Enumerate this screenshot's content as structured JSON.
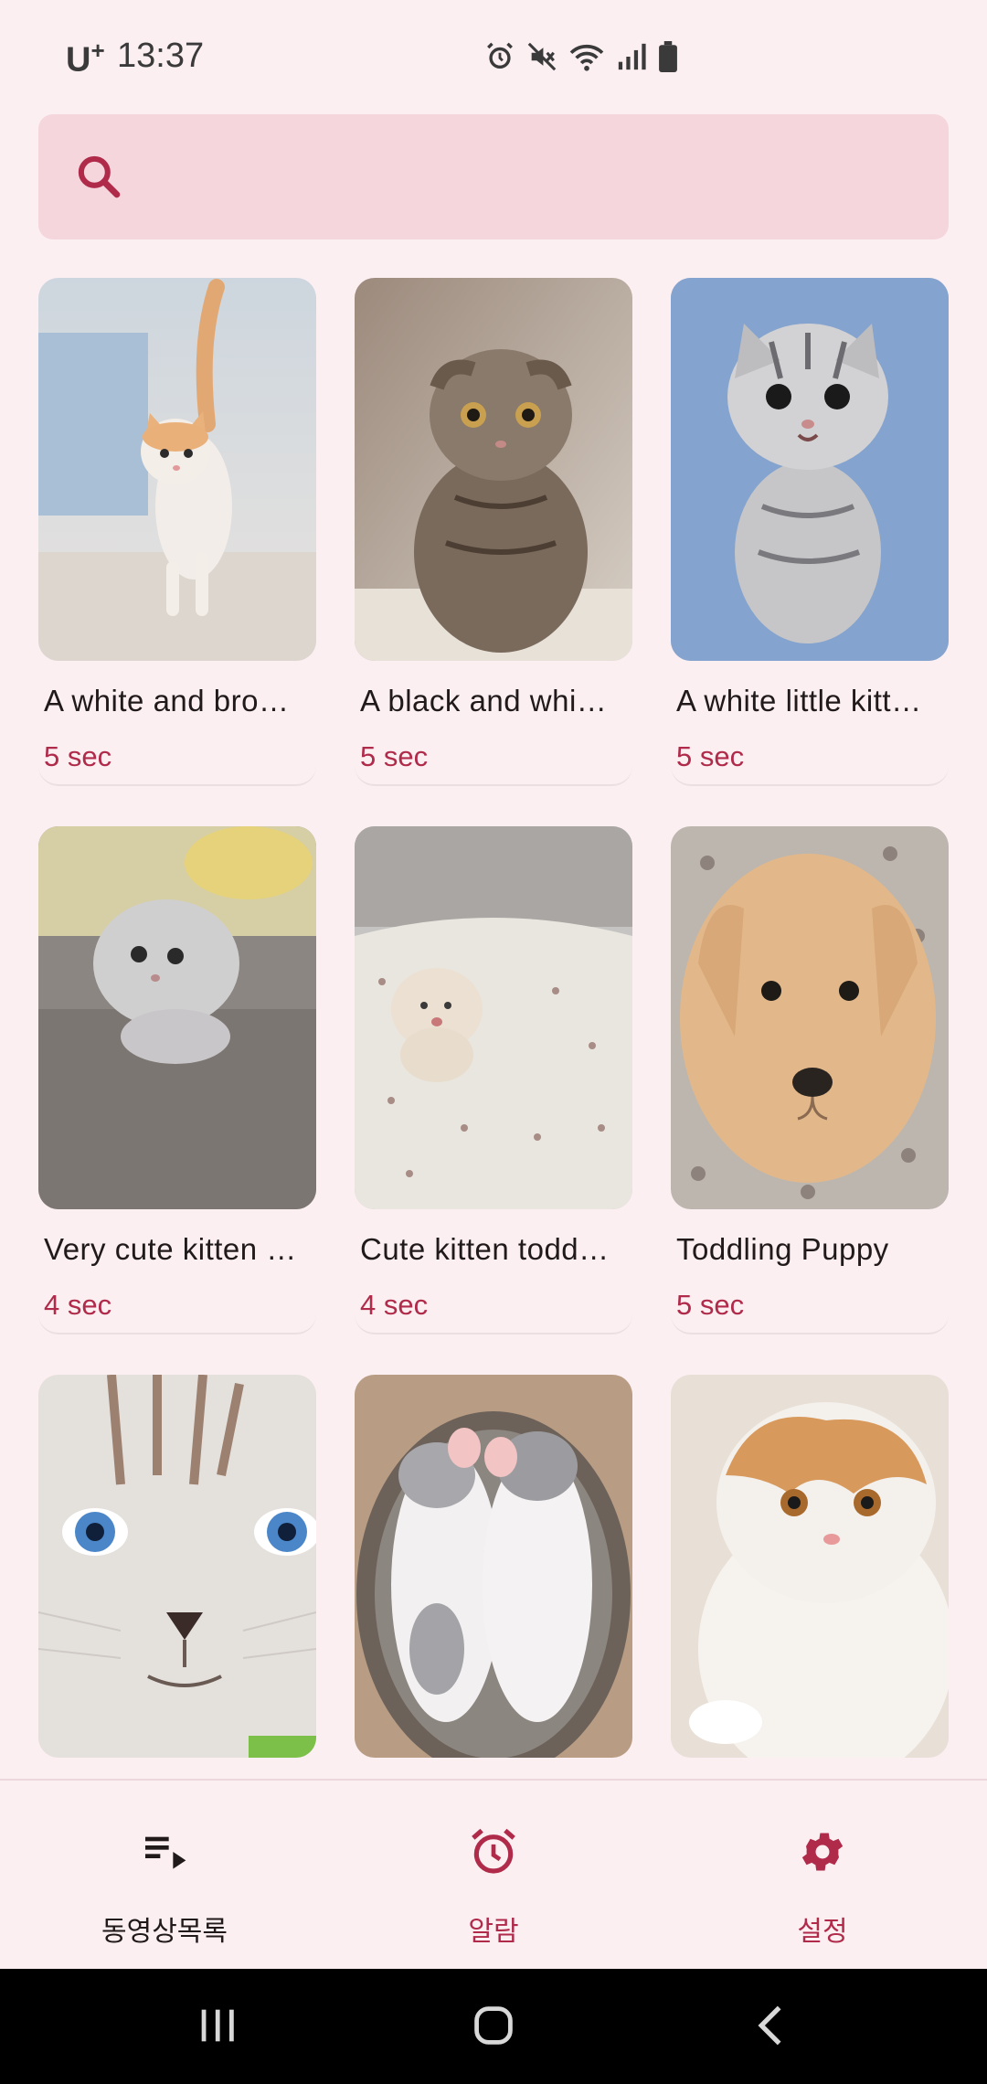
{
  "status_bar": {
    "carrier": "U",
    "carrier_sup": "+",
    "time": "13:37",
    "icons": [
      "alarm-icon",
      "mute-icon",
      "wifi-icon",
      "signal-icon",
      "battery-icon"
    ]
  },
  "search": {
    "placeholder": "",
    "value": "",
    "icon": "search-icon"
  },
  "videos": [
    {
      "title": "A white and bro…",
      "duration": "5 sec"
    },
    {
      "title": "A black and whi…",
      "duration": "5 sec"
    },
    {
      "title": "A white little kitt…",
      "duration": "5 sec"
    },
    {
      "title": "Very cute kitten …",
      "duration": "4 sec"
    },
    {
      "title": "Cute kitten todd…",
      "duration": "4 sec"
    },
    {
      "title": "Toddling Puppy",
      "duration": "5 sec"
    },
    {
      "title": "",
      "duration": ""
    },
    {
      "title": "",
      "duration": ""
    },
    {
      "title": "",
      "duration": ""
    }
  ],
  "bottom_nav": {
    "items": [
      {
        "label": "동영상목록",
        "icon": "playlist-icon"
      },
      {
        "label": "알람",
        "icon": "alarm-clock-icon"
      },
      {
        "label": "설정",
        "icon": "gear-icon"
      }
    ]
  },
  "colors": {
    "background": "#fbeff2",
    "search_bg": "#f5d6dd",
    "accent": "#b02a4a",
    "text": "#201a1b"
  }
}
